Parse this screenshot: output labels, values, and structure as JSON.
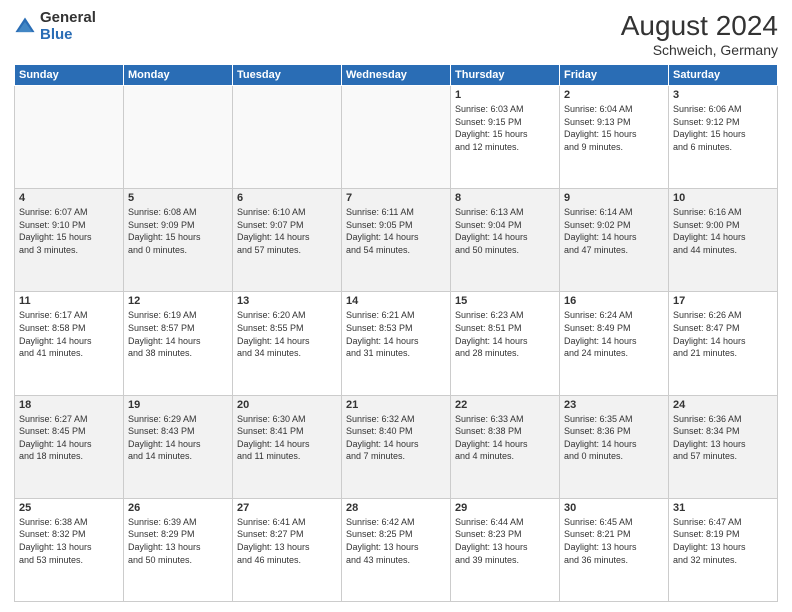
{
  "header": {
    "logo_general": "General",
    "logo_blue": "Blue",
    "month_year": "August 2024",
    "location": "Schweich, Germany"
  },
  "days_of_week": [
    "Sunday",
    "Monday",
    "Tuesday",
    "Wednesday",
    "Thursday",
    "Friday",
    "Saturday"
  ],
  "weeks": [
    [
      {
        "day": "",
        "info": ""
      },
      {
        "day": "",
        "info": ""
      },
      {
        "day": "",
        "info": ""
      },
      {
        "day": "",
        "info": ""
      },
      {
        "day": "1",
        "info": "Sunrise: 6:03 AM\nSunset: 9:15 PM\nDaylight: 15 hours\nand 12 minutes."
      },
      {
        "day": "2",
        "info": "Sunrise: 6:04 AM\nSunset: 9:13 PM\nDaylight: 15 hours\nand 9 minutes."
      },
      {
        "day": "3",
        "info": "Sunrise: 6:06 AM\nSunset: 9:12 PM\nDaylight: 15 hours\nand 6 minutes."
      }
    ],
    [
      {
        "day": "4",
        "info": "Sunrise: 6:07 AM\nSunset: 9:10 PM\nDaylight: 15 hours\nand 3 minutes."
      },
      {
        "day": "5",
        "info": "Sunrise: 6:08 AM\nSunset: 9:09 PM\nDaylight: 15 hours\nand 0 minutes."
      },
      {
        "day": "6",
        "info": "Sunrise: 6:10 AM\nSunset: 9:07 PM\nDaylight: 14 hours\nand 57 minutes."
      },
      {
        "day": "7",
        "info": "Sunrise: 6:11 AM\nSunset: 9:05 PM\nDaylight: 14 hours\nand 54 minutes."
      },
      {
        "day": "8",
        "info": "Sunrise: 6:13 AM\nSunset: 9:04 PM\nDaylight: 14 hours\nand 50 minutes."
      },
      {
        "day": "9",
        "info": "Sunrise: 6:14 AM\nSunset: 9:02 PM\nDaylight: 14 hours\nand 47 minutes."
      },
      {
        "day": "10",
        "info": "Sunrise: 6:16 AM\nSunset: 9:00 PM\nDaylight: 14 hours\nand 44 minutes."
      }
    ],
    [
      {
        "day": "11",
        "info": "Sunrise: 6:17 AM\nSunset: 8:58 PM\nDaylight: 14 hours\nand 41 minutes."
      },
      {
        "day": "12",
        "info": "Sunrise: 6:19 AM\nSunset: 8:57 PM\nDaylight: 14 hours\nand 38 minutes."
      },
      {
        "day": "13",
        "info": "Sunrise: 6:20 AM\nSunset: 8:55 PM\nDaylight: 14 hours\nand 34 minutes."
      },
      {
        "day": "14",
        "info": "Sunrise: 6:21 AM\nSunset: 8:53 PM\nDaylight: 14 hours\nand 31 minutes."
      },
      {
        "day": "15",
        "info": "Sunrise: 6:23 AM\nSunset: 8:51 PM\nDaylight: 14 hours\nand 28 minutes."
      },
      {
        "day": "16",
        "info": "Sunrise: 6:24 AM\nSunset: 8:49 PM\nDaylight: 14 hours\nand 24 minutes."
      },
      {
        "day": "17",
        "info": "Sunrise: 6:26 AM\nSunset: 8:47 PM\nDaylight: 14 hours\nand 21 minutes."
      }
    ],
    [
      {
        "day": "18",
        "info": "Sunrise: 6:27 AM\nSunset: 8:45 PM\nDaylight: 14 hours\nand 18 minutes."
      },
      {
        "day": "19",
        "info": "Sunrise: 6:29 AM\nSunset: 8:43 PM\nDaylight: 14 hours\nand 14 minutes."
      },
      {
        "day": "20",
        "info": "Sunrise: 6:30 AM\nSunset: 8:41 PM\nDaylight: 14 hours\nand 11 minutes."
      },
      {
        "day": "21",
        "info": "Sunrise: 6:32 AM\nSunset: 8:40 PM\nDaylight: 14 hours\nand 7 minutes."
      },
      {
        "day": "22",
        "info": "Sunrise: 6:33 AM\nSunset: 8:38 PM\nDaylight: 14 hours\nand 4 minutes."
      },
      {
        "day": "23",
        "info": "Sunrise: 6:35 AM\nSunset: 8:36 PM\nDaylight: 14 hours\nand 0 minutes."
      },
      {
        "day": "24",
        "info": "Sunrise: 6:36 AM\nSunset: 8:34 PM\nDaylight: 13 hours\nand 57 minutes."
      }
    ],
    [
      {
        "day": "25",
        "info": "Sunrise: 6:38 AM\nSunset: 8:32 PM\nDaylight: 13 hours\nand 53 minutes."
      },
      {
        "day": "26",
        "info": "Sunrise: 6:39 AM\nSunset: 8:29 PM\nDaylight: 13 hours\nand 50 minutes."
      },
      {
        "day": "27",
        "info": "Sunrise: 6:41 AM\nSunset: 8:27 PM\nDaylight: 13 hours\nand 46 minutes."
      },
      {
        "day": "28",
        "info": "Sunrise: 6:42 AM\nSunset: 8:25 PM\nDaylight: 13 hours\nand 43 minutes."
      },
      {
        "day": "29",
        "info": "Sunrise: 6:44 AM\nSunset: 8:23 PM\nDaylight: 13 hours\nand 39 minutes."
      },
      {
        "day": "30",
        "info": "Sunrise: 6:45 AM\nSunset: 8:21 PM\nDaylight: 13 hours\nand 36 minutes."
      },
      {
        "day": "31",
        "info": "Sunrise: 6:47 AM\nSunset: 8:19 PM\nDaylight: 13 hours\nand 32 minutes."
      }
    ]
  ]
}
